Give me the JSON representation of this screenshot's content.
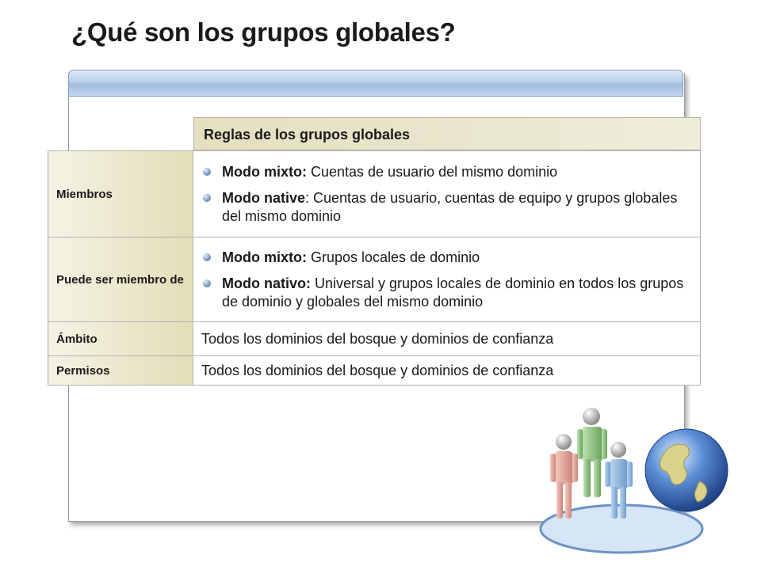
{
  "slide": {
    "title": "¿Qué son los grupos globales?"
  },
  "table": {
    "header": "Reglas de los grupos globales",
    "rows": [
      {
        "label": "Miembros",
        "bullets": [
          {
            "bold": "Modo mixto:",
            "text": " Cuentas de usuario del mismo dominio"
          },
          {
            "bold": "Modo native",
            "text": ": Cuentas de usuario, cuentas de equipo y grupos globales del mismo dominio"
          }
        ]
      },
      {
        "label": "Puede ser miembro de",
        "bullets": [
          {
            "bold": "Modo mixto:",
            "text": " Grupos locales de dominio"
          },
          {
            "bold": "Modo nativo:",
            "text": " Universal y grupos locales de dominio en todos los grupos de dominio y globales del mismo dominio"
          }
        ]
      },
      {
        "label": "Ámbito",
        "value": "Todos los dominios del bosque y dominios de confianza"
      },
      {
        "label": "Permisos",
        "value": "Todos los dominios del bosque y dominios de confianza"
      }
    ]
  },
  "colors": {
    "panel_bar": "#b8cfe9",
    "label_fill": "#e3ddb7",
    "header_fill": "#e4dfbf"
  },
  "icons": [
    "bullet-dot-icon",
    "users-globe-clipart"
  ]
}
